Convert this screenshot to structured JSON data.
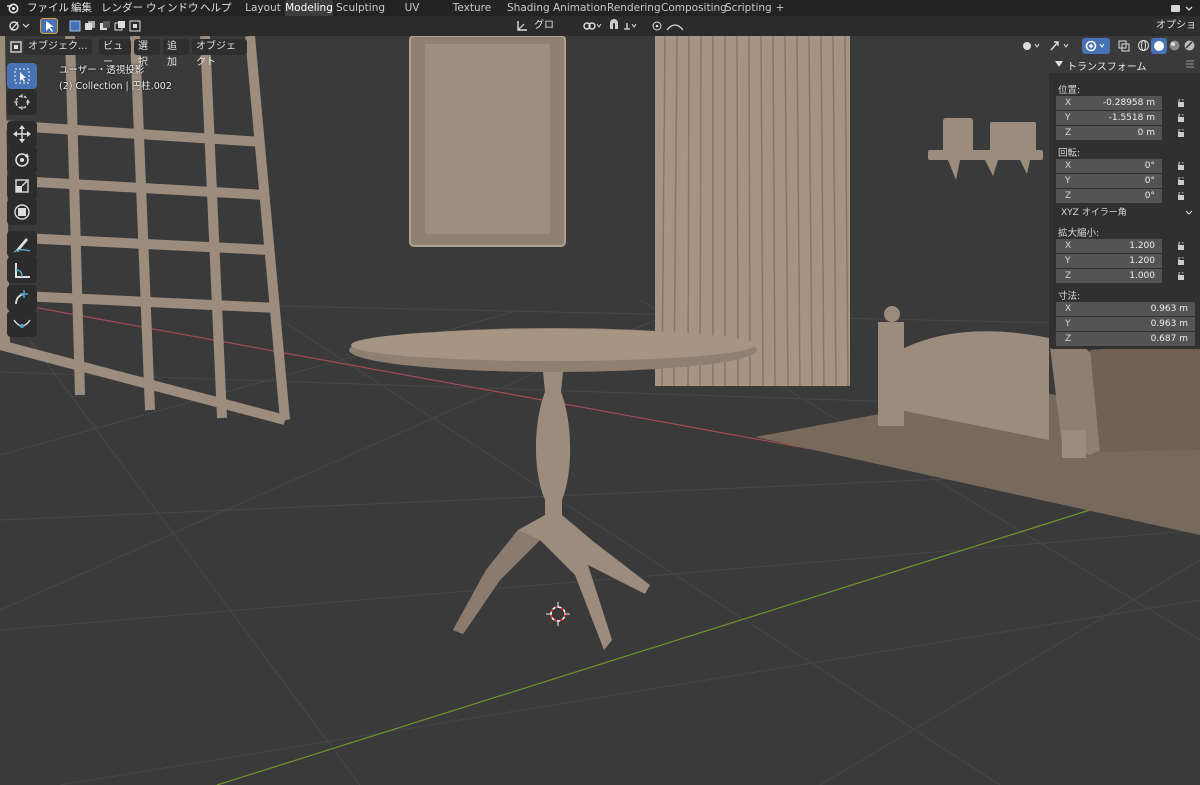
{
  "app": {
    "menu": [
      "ファイル",
      "編集",
      "レンダー",
      "ウィンドウ",
      "ヘルプ"
    ]
  },
  "workspaces": {
    "tabs": [
      "Layout",
      "Modeling",
      "Sculpting",
      "UV Editing",
      "Texture Paint",
      "Shading",
      "Animation",
      "Rendering",
      "Compositing",
      "Scripting"
    ],
    "active": "Modeling",
    "add": "+"
  },
  "header": {
    "orientation": "グロー...",
    "options": "オプション",
    "mode": "オブジェク...",
    "view": "ビュー",
    "select": "選択",
    "add": "追加",
    "object": "オブジェクト"
  },
  "viewport": {
    "perspective": "ユーザー・透視投影",
    "collection": "(2) Collection | 円柱.002"
  },
  "tools": [
    "select-box-icon",
    "cursor-icon",
    "move-icon",
    "rotate-icon",
    "scale-icon",
    "transform-icon",
    "annotate-icon",
    "measure-icon",
    "add-cube-icon",
    "curve-draw-icon"
  ],
  "npanel": {
    "title": "トランスフォーム",
    "location_label": "位置:",
    "location": [
      {
        "axis": "X",
        "value": "-0.28958 m"
      },
      {
        "axis": "Y",
        "value": "-1.5518 m"
      },
      {
        "axis": "Z",
        "value": "0 m"
      }
    ],
    "rotation_label": "回転:",
    "rotation": [
      {
        "axis": "X",
        "value": "0°"
      },
      {
        "axis": "Y",
        "value": "0°"
      },
      {
        "axis": "Z",
        "value": "0°"
      }
    ],
    "rotation_mode": "XYZ オイラー角",
    "scale_label": "拡大縮小:",
    "scale": [
      {
        "axis": "X",
        "value": "1.200"
      },
      {
        "axis": "Y",
        "value": "1.200"
      },
      {
        "axis": "Z",
        "value": "1.000"
      }
    ],
    "dimensions_label": "寸法:",
    "dimensions": [
      {
        "axis": "X",
        "value": "0.963 m"
      },
      {
        "axis": "Y",
        "value": "0.963 m"
      },
      {
        "axis": "Z",
        "value": "0.687 m"
      }
    ]
  },
  "colors": {
    "active_tool": "#4772b3",
    "model": "#9c8c7e",
    "x_axis": "#a54a52",
    "y_axis": "#6b9630"
  }
}
